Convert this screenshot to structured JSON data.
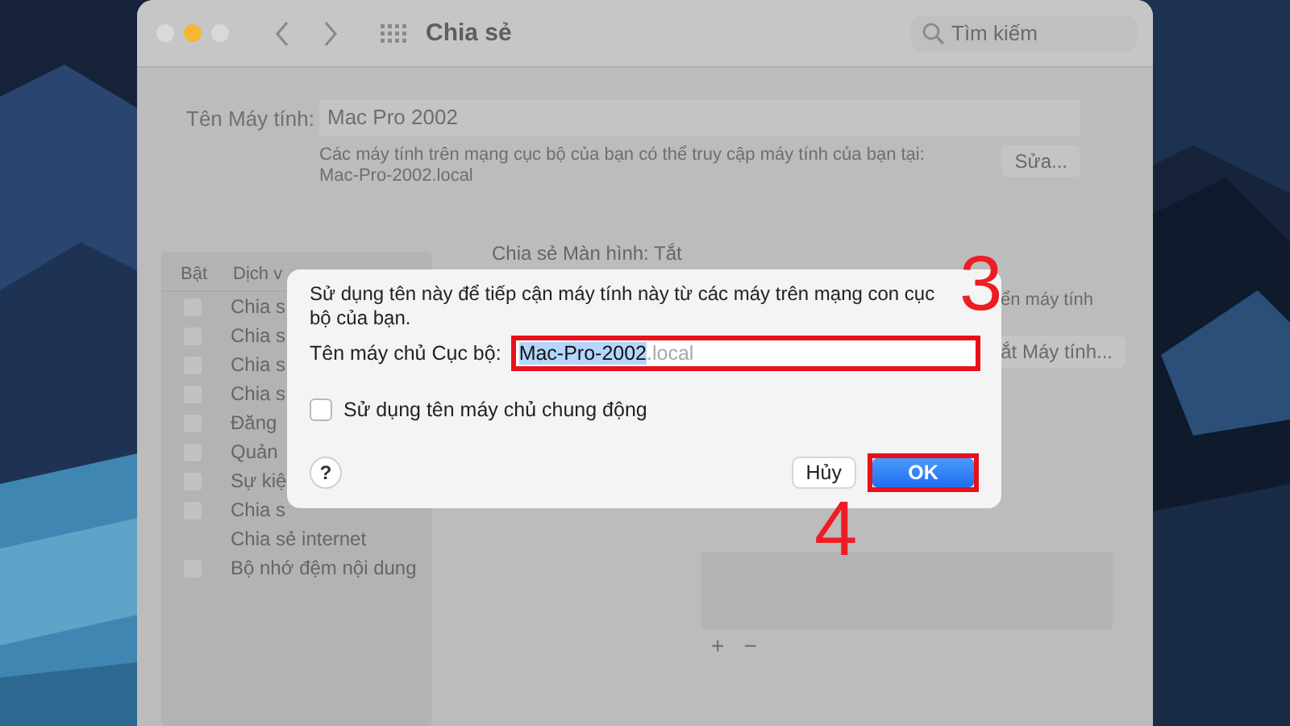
{
  "window": {
    "title": "Chia sẻ",
    "search": {
      "placeholder": "Tìm kiếm"
    },
    "traffic_lights": [
      {
        "color": "#d9d9d9"
      },
      {
        "color": "#f5b82e"
      },
      {
        "color": "#d9d9d9"
      }
    ]
  },
  "computer_name": {
    "label": "Tên Máy tính:",
    "value": "Mac Pro 2002",
    "note": "Các máy tính trên mạng cục bộ của bạn có thể truy cập máy tính của bạn tại:",
    "address": "Mac-Pro-2002.local",
    "button": "Sửa..."
  },
  "services": {
    "columns": [
      "Bật",
      "Dịch v"
    ],
    "rows": [
      {
        "kind": "checkbox",
        "name": "Chia s",
        "checked": false
      },
      {
        "kind": "checkbox",
        "name": "Chia s",
        "checked": false
      },
      {
        "kind": "checkbox",
        "name": "Chia s",
        "checked": false
      },
      {
        "kind": "checkbox",
        "name": "Chia s",
        "checked": false
      },
      {
        "kind": "checkbox",
        "name": "Đăng",
        "checked": false
      },
      {
        "kind": "checkbox",
        "name": "Quản",
        "checked": false
      },
      {
        "kind": "checkbox",
        "name": "Sự kiệ",
        "checked": false
      },
      {
        "kind": "checkbox",
        "name": "Chia s",
        "checked": false
      },
      {
        "kind": "plain",
        "name": "Chia sẻ internet"
      },
      {
        "kind": "checkbox",
        "name": "Bộ nhớ đệm nội dung",
        "checked": false
      }
    ]
  },
  "screen_sharing": {
    "status": "Chia sẻ Màn hình: Tắt",
    "note": "ển máy tính",
    "button": "ắt Máy tính...",
    "list_buttons": [
      "+",
      "−"
    ]
  },
  "sheet": {
    "message": "Sử dụng tên này để tiếp cận máy tính này từ các máy trên mạng con cục bộ của bạn.",
    "hostname_label": "Tên máy chủ Cục bộ:",
    "hostname_selected": "Mac-Pro-2002",
    "hostname_suffix": ".local",
    "hostname_highlighted": true,
    "dynamic": {
      "label": "Sử dụng tên máy chủ chung động",
      "checked": false
    },
    "help": "?",
    "cancel": "Hủy",
    "ok": "OK",
    "ok_highlighted": true
  },
  "annotations": [
    {
      "text": "3"
    },
    {
      "text": "4"
    }
  ]
}
